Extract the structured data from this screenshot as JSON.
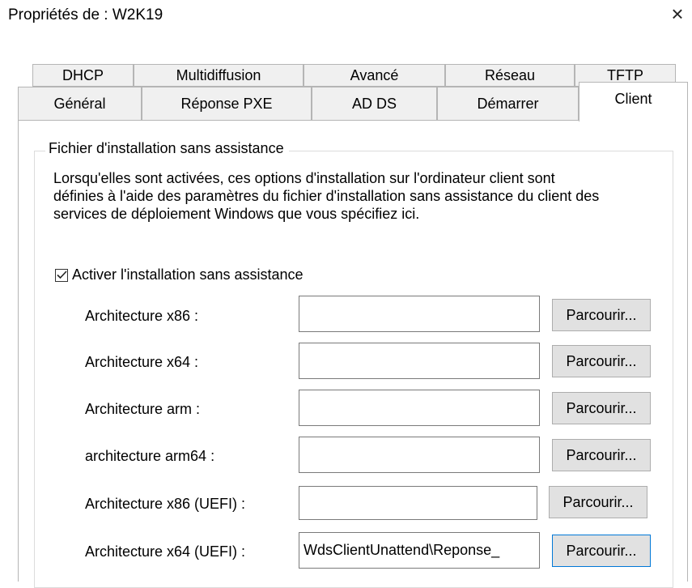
{
  "window": {
    "title": "Propriétés de : W2K19",
    "close_glyph": "×"
  },
  "tabs": {
    "row1": [
      "DHCP",
      "Multidiffusion",
      "Avancé",
      "Réseau",
      "TFTP"
    ],
    "row2": [
      "Général",
      "Réponse PXE",
      "AD DS",
      "Démarrer",
      "Client"
    ],
    "active": "Client"
  },
  "group": {
    "legend": "Fichier d'installation sans assistance",
    "description": "Lorsqu'elles sont activées, ces options d'installation sur l'ordinateur client sont définies à l'aide des paramètres du fichier d'installation sans assistance du client des services de déploiement Windows que vous spécifiez ici.",
    "enable_checkbox": {
      "label": "Activer l'installation sans assistance",
      "checked": true
    }
  },
  "architectures": [
    {
      "label": "Architecture x86 :",
      "value": "",
      "browse_label": "Parcourir..."
    },
    {
      "label": "Architecture x64 :",
      "value": "",
      "browse_label": "Parcourir..."
    },
    {
      "label": "Architecture arm :",
      "value": "",
      "browse_label": "Parcourir..."
    },
    {
      "label": "architecture arm64 :",
      "value": "",
      "browse_label": "Parcourir..."
    },
    {
      "label": "Architecture x86 (UEFI) :",
      "value": "",
      "browse_label": "Parcourir..."
    },
    {
      "label": "Architecture x64 (UEFI) :",
      "value": "WdsClientUnattend\\Reponse_",
      "browse_label": "Parcourir..."
    }
  ],
  "colors": {
    "tab_bg": "#f0f0f0",
    "border": "#b5b5b5",
    "button_bg": "#e1e1e1",
    "focus": "#0078d7"
  },
  "icons": {
    "close": "close-icon",
    "checkbox": "checkmark-icon"
  }
}
